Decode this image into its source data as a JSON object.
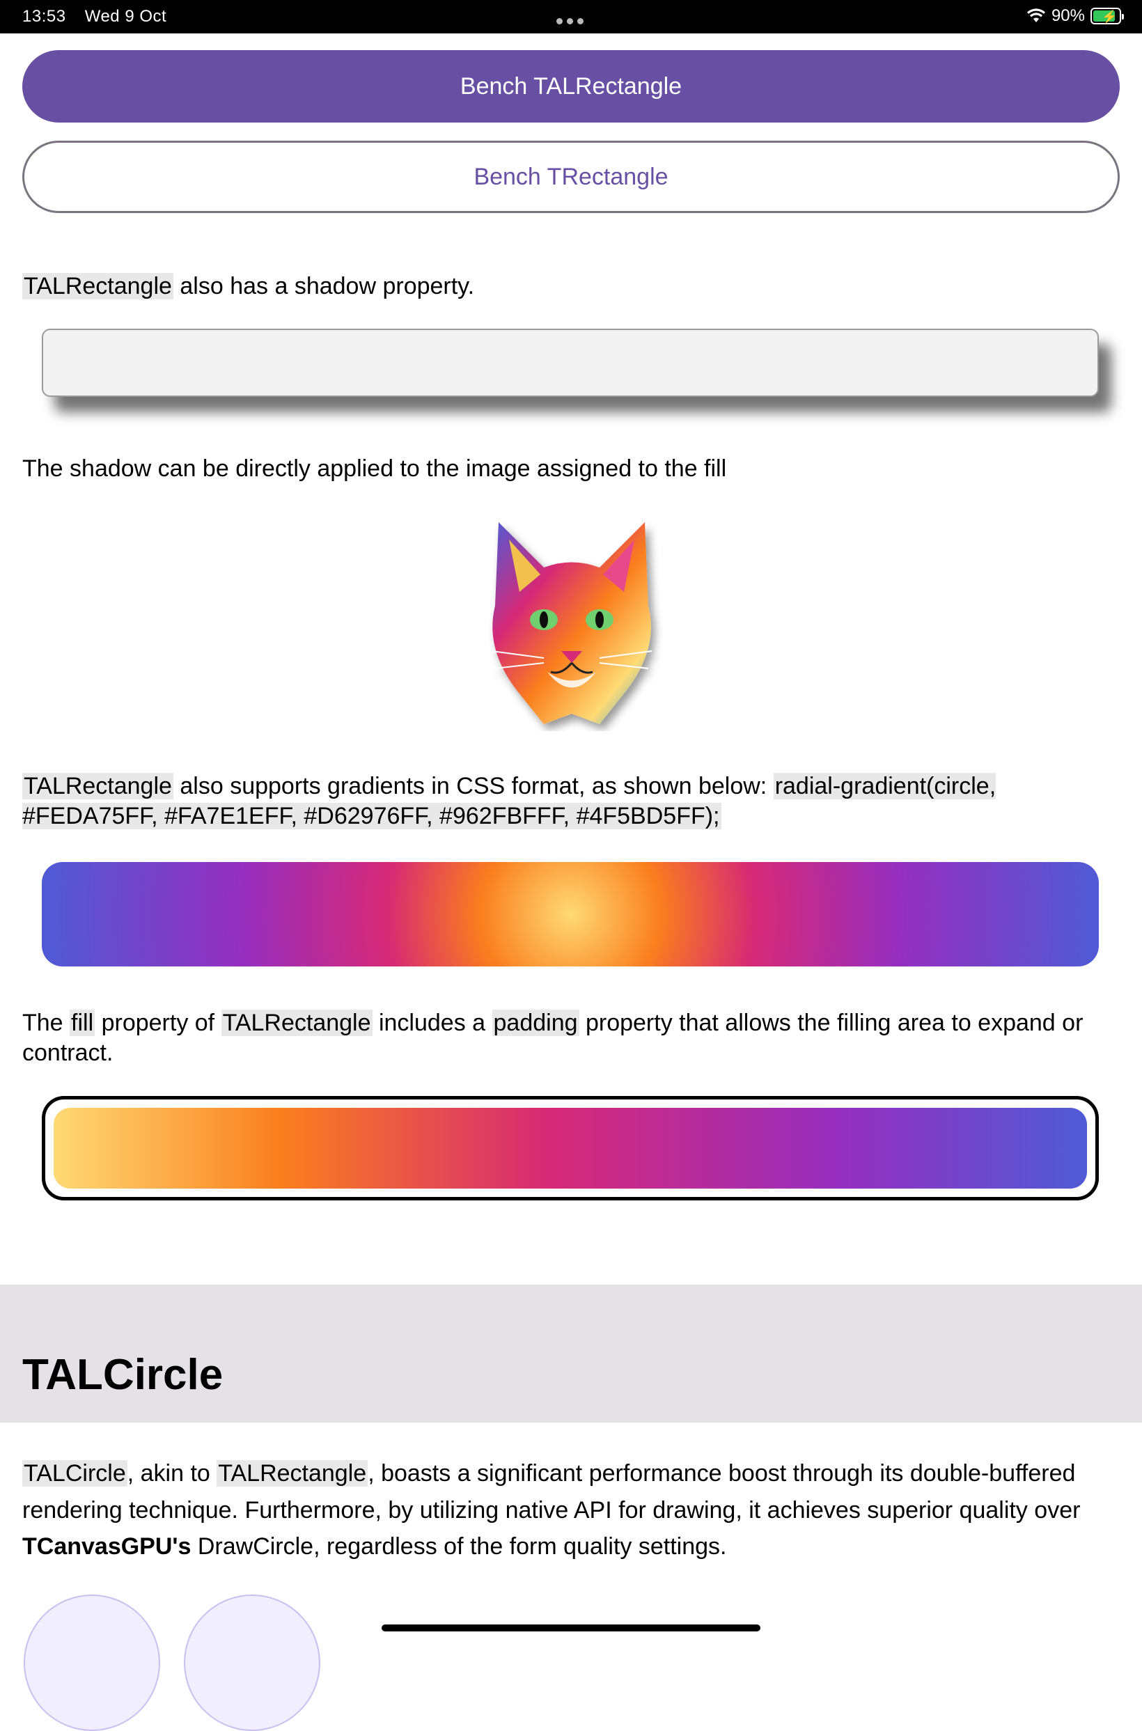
{
  "status_bar": {
    "time": "13:53",
    "date": "Wed 9 Oct",
    "battery_percent": "90%",
    "battery_level": 0.9
  },
  "buttons": {
    "bench_alrectangle": "Bench TALRectangle",
    "bench_trectangle": "Bench TRectangle"
  },
  "shadow_section": {
    "code": "TALRectangle",
    "text": " also has a shadow property."
  },
  "image_shadow_section": {
    "text": "The shadow can be directly applied to the image assigned to the fill"
  },
  "gradient_section": {
    "code1": "TALRectangle",
    "text": " also supports gradients in CSS format, as shown below: ",
    "code2": "radial-gradient(circle, #FEDA75FF, #FA7E1EFF, #D62976FF, #962FBFFF, #4F5BD5FF);",
    "colors": [
      "#FEDA75",
      "#FA7E1E",
      "#D62976",
      "#962FBF",
      "#4F5BD5"
    ]
  },
  "padding_section": {
    "t1": "The ",
    "code1": "fill",
    "t2": " property of ",
    "code2": "TALRectangle",
    "t3": " includes a ",
    "code3": "padding",
    "t4": " property that allows the filling area to expand or contract."
  },
  "circle_section": {
    "title": "TALCircle",
    "code1": "TALCircle",
    "t1": ", akin to ",
    "code2": "TALRectangle",
    "t2": ", boasts a significant performance boost through its double-buffered rendering technique. Furthermore, by utilizing native API for drawing, it achieves superior quality over ",
    "bold1": "TCanvasGPU's",
    "t3": " DrawCircle, regardless of the form quality settings."
  },
  "colors": {
    "primary": "#6750a4",
    "section_band": "#e5e1e7",
    "code_bg": "#e8e8e8"
  }
}
